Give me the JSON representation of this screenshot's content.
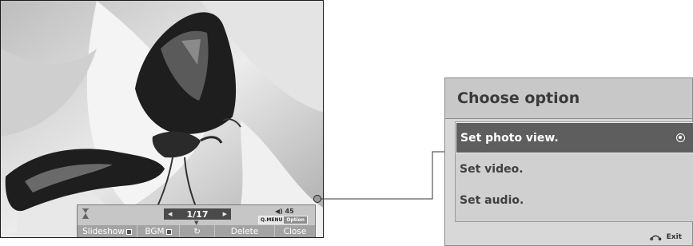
{
  "viewer": {
    "counter": "1/17",
    "volume": "45",
    "qmenu_key": "Q.MENU",
    "qmenu_value": "Option",
    "buttons": {
      "slideshow": "Slideshow",
      "bgm": "BGM",
      "rotate_glyph": "↻",
      "delete": "Delete",
      "close": "Close"
    }
  },
  "panel": {
    "title": "Choose option",
    "items": [
      {
        "label": "Set photo view.",
        "selected": true
      },
      {
        "label": "Set video.",
        "selected": false
      },
      {
        "label": "Set audio.",
        "selected": false
      }
    ],
    "exit_label": "Exit"
  },
  "colors": {
    "panel_bg": "#d8d8d8",
    "selected_item": "#5e5e5e",
    "osd_bar": "#c6c6c6"
  }
}
